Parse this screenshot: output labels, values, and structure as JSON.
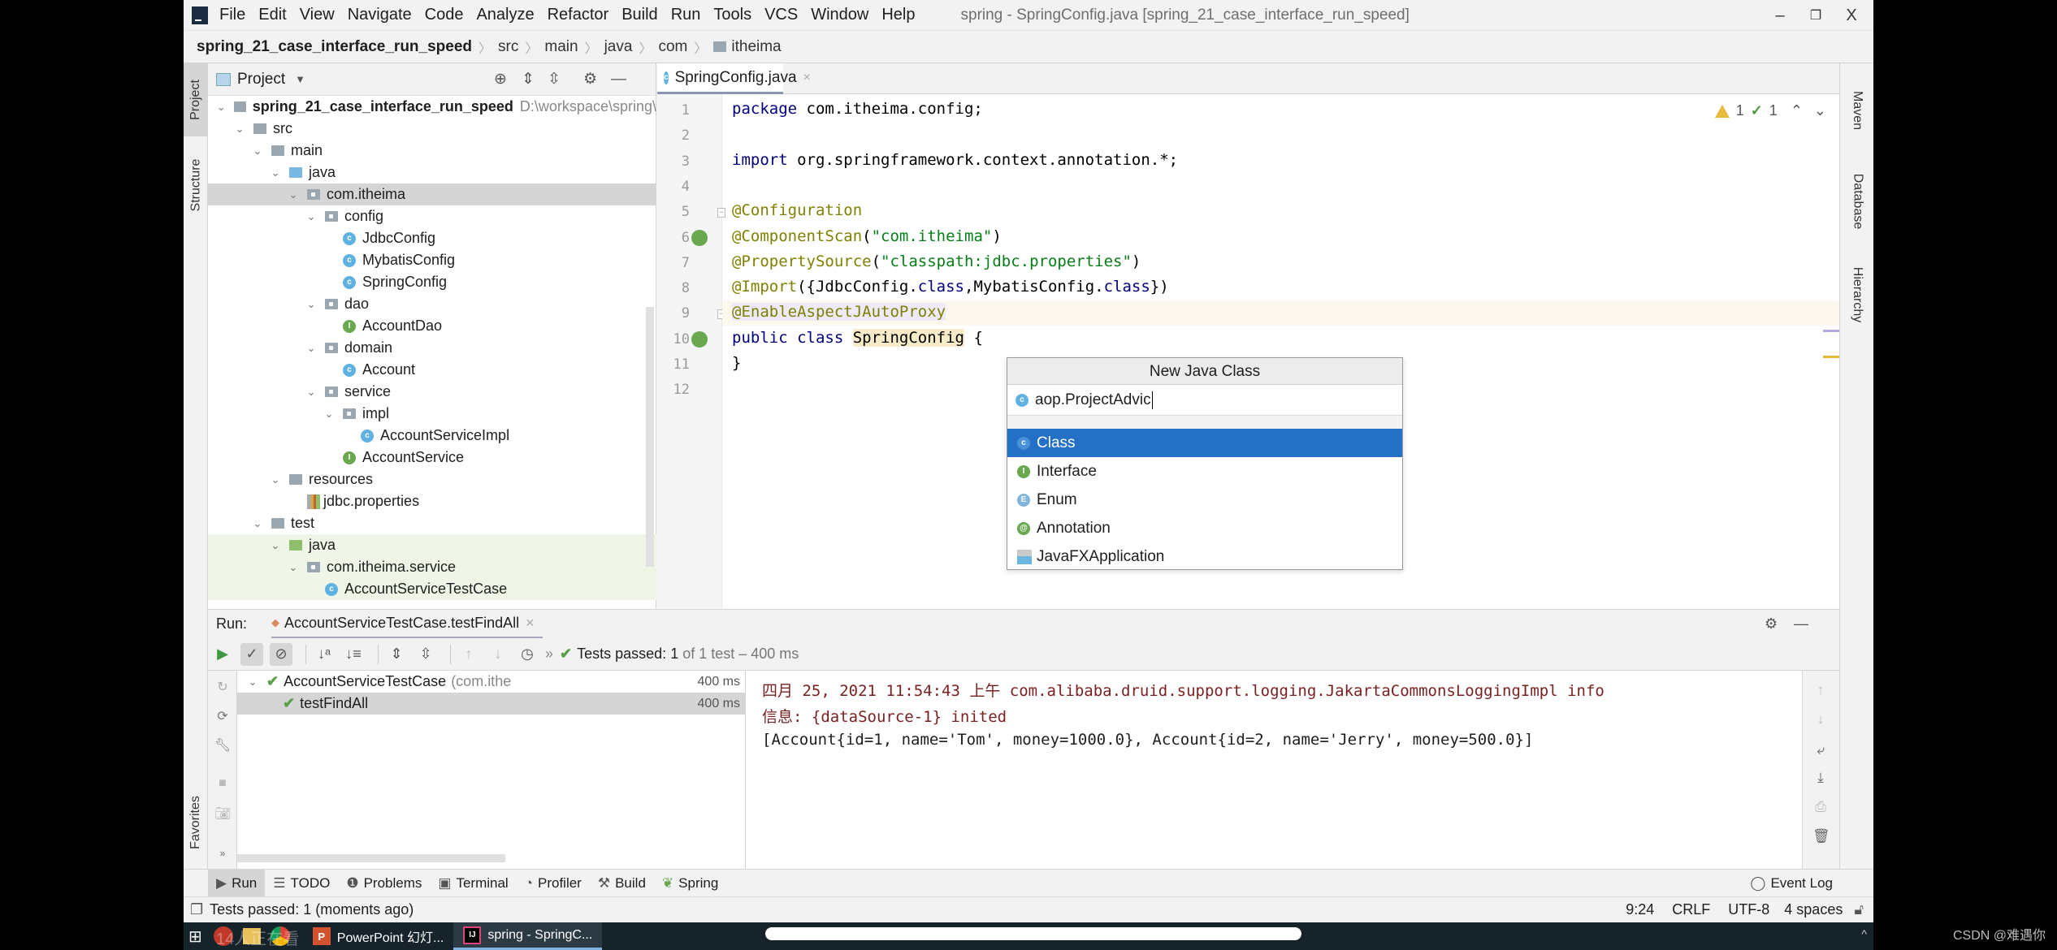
{
  "window": {
    "title": "spring - SpringConfig.java [spring_21_case_interface_run_speed]",
    "controls": {
      "minimize": "–",
      "restore": "❐",
      "close": "X"
    }
  },
  "menu": [
    "File",
    "Edit",
    "View",
    "Navigate",
    "Code",
    "Analyze",
    "Refactor",
    "Build",
    "Run",
    "Tools",
    "VCS",
    "Window",
    "Help"
  ],
  "breadcrumb": [
    "spring_21_case_interface_run_speed",
    "src",
    "main",
    "java",
    "com",
    "itheima"
  ],
  "run_config": {
    "label": "AccountServiceTestCase.testFindAll"
  },
  "left_tool_tabs": [
    "Project",
    "Structure",
    "Favorites"
  ],
  "right_tool_tabs": [
    "Maven",
    "Database",
    "Hierarchy"
  ],
  "project_panel": {
    "title": "Project",
    "tree": [
      {
        "label": "spring_21_case_interface_run_speed",
        "hint": "D:\\workspace\\spring\\",
        "type": "module",
        "depth": 0,
        "expanded": true
      },
      {
        "label": "src",
        "type": "folder",
        "depth": 1,
        "expanded": true
      },
      {
        "label": "main",
        "type": "folder",
        "depth": 2,
        "expanded": true
      },
      {
        "label": "java",
        "type": "src-folder",
        "depth": 3,
        "expanded": true
      },
      {
        "label": "com.itheima",
        "type": "package",
        "depth": 4,
        "expanded": true,
        "selected": true
      },
      {
        "label": "config",
        "type": "package",
        "depth": 5,
        "expanded": true
      },
      {
        "label": "JdbcConfig",
        "type": "class",
        "depth": 6
      },
      {
        "label": "MybatisConfig",
        "type": "class",
        "depth": 6
      },
      {
        "label": "SpringConfig",
        "type": "class",
        "depth": 6
      },
      {
        "label": "dao",
        "type": "package",
        "depth": 5,
        "expanded": true
      },
      {
        "label": "AccountDao",
        "type": "interface",
        "depth": 6
      },
      {
        "label": "domain",
        "type": "package",
        "depth": 5,
        "expanded": true
      },
      {
        "label": "Account",
        "type": "class",
        "depth": 6
      },
      {
        "label": "service",
        "type": "package",
        "depth": 5,
        "expanded": true
      },
      {
        "label": "impl",
        "type": "package",
        "depth": 6,
        "expanded": true
      },
      {
        "label": "AccountServiceImpl",
        "type": "class",
        "depth": 7
      },
      {
        "label": "AccountService",
        "type": "interface",
        "depth": 6
      },
      {
        "label": "resources",
        "type": "res-folder",
        "depth": 3,
        "expanded": true
      },
      {
        "label": "jdbc.properties",
        "type": "properties",
        "depth": 4
      },
      {
        "label": "test",
        "type": "folder",
        "depth": 2,
        "expanded": true
      },
      {
        "label": "java",
        "type": "test-folder",
        "depth": 3,
        "expanded": true
      },
      {
        "label": "com.itheima.service",
        "type": "package",
        "depth": 4,
        "expanded": true
      },
      {
        "label": "AccountServiceTestCase",
        "type": "test-class",
        "depth": 5
      }
    ]
  },
  "editor": {
    "tab": "SpringConfig.java",
    "inspections": {
      "warnings": "1",
      "weak_warnings": "1"
    },
    "lines": [
      [
        {
          "t": "package ",
          "c": "kw"
        },
        {
          "t": "com.itheima.config;"
        }
      ],
      [],
      [
        {
          "t": "import ",
          "c": "kw"
        },
        {
          "t": "org.springframework.context.annotation.*;"
        }
      ],
      [],
      [
        {
          "t": "@Configuration",
          "c": "ann"
        }
      ],
      [
        {
          "t": "@ComponentScan",
          "c": "ann"
        },
        {
          "t": "("
        },
        {
          "t": "\"com.itheima\"",
          "c": "str"
        },
        {
          "t": ")"
        }
      ],
      [
        {
          "t": "@PropertySource",
          "c": "ann"
        },
        {
          "t": "("
        },
        {
          "t": "\"classpath:jdbc.properties\"",
          "c": "str"
        },
        {
          "t": ")"
        }
      ],
      [
        {
          "t": "@Import",
          "c": "ann"
        },
        {
          "t": "({JdbcConfig."
        },
        {
          "t": "class",
          "c": "kw"
        },
        {
          "t": ",MybatisConfig."
        },
        {
          "t": "class",
          "c": "kw"
        },
        {
          "t": "})"
        }
      ],
      [
        {
          "t": "@EnableAspectJAutoProxy",
          "c": "ann hl-ann"
        }
      ],
      [
        {
          "t": "public ",
          "c": "kw"
        },
        {
          "t": "class ",
          "c": "kw"
        },
        {
          "t": "SpringConfig",
          "c": "hl-word"
        },
        {
          "t": " {"
        }
      ],
      [
        {
          "t": "}"
        }
      ],
      []
    ]
  },
  "new_class_popup": {
    "title": "New Java Class",
    "input_value": "aop.ProjectAdvic",
    "kinds": [
      {
        "label": "Class",
        "icon": "class",
        "selected": true
      },
      {
        "label": "Interface",
        "icon": "interface"
      },
      {
        "label": "Enum",
        "icon": "enum"
      },
      {
        "label": "Annotation",
        "icon": "annotation"
      },
      {
        "label": "JavaFXApplication",
        "icon": "javafx"
      }
    ]
  },
  "run_panel": {
    "label": "Run:",
    "tab": "AccountServiceTestCase.testFindAll",
    "status_prefix": "Tests passed:",
    "status_count": "1",
    "status_suffix": "of 1 test – 400 ms",
    "tests": [
      {
        "name": "AccountServiceTestCase",
        "hint": "(com.ithe",
        "time": "400 ms",
        "passed": true
      },
      {
        "name": "testFindAll",
        "time": "400 ms",
        "passed": true,
        "selected": true
      }
    ],
    "console": [
      {
        "text": "四月 25, 2021 11:54:43 上午 com.alibaba.druid.support.logging.JakartaCommonsLoggingImpl info",
        "style": "red"
      },
      {
        "text": "信息: {dataSource-1} inited",
        "style": "red"
      },
      {
        "text": "[Account{id=1, name='Tom', money=1000.0}, Account{id=2, name='Jerry', money=500.0}]",
        "style": "normal"
      }
    ]
  },
  "bottom_tabs": [
    "Run",
    "TODO",
    "Problems",
    "Terminal",
    "Profiler",
    "Build",
    "Spring"
  ],
  "event_log": "Event Log",
  "status_bar": {
    "message": "Tests passed: 1 (moments ago)",
    "position": "9:24",
    "line_sep": "CRLF",
    "encoding": "UTF-8",
    "indent": "4 spaces"
  },
  "taskbar": {
    "apps": [
      {
        "label": "PowerPoint 幻灯...",
        "icon": "powerpoint"
      },
      {
        "label": "spring - SpringC...",
        "icon": "intellij",
        "active": true
      }
    ],
    "overlay": "14人正在看"
  },
  "watermark": "CSDN @难遇你",
  "colors": {
    "accent": "#2470c6",
    "pass": "#5aa04a",
    "annotation": "#808000",
    "string": "#067d17",
    "keyword": "#000080"
  }
}
